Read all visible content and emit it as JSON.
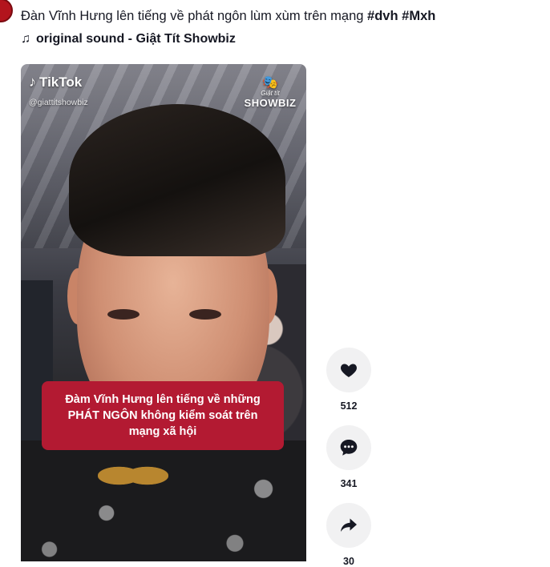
{
  "post": {
    "caption_text": "Đàn Vĩnh Hưng lên tiếng về phát ngôn lùm xùm trên mạng ",
    "hashtags": [
      "#dvh",
      "#Mxh"
    ],
    "music_icon": "music-note-icon",
    "music_label": "original sound - Giật Tít Showbiz"
  },
  "video": {
    "platform_label": "TikTok",
    "handle": "@giattitshowbiz",
    "brand_small": "Giật tít",
    "brand_name": "SHOWBIZ",
    "headline": "Đàm Vĩnh Hưng lên tiếng về những PHÁT NGÔN không kiểm soát trên mạng xã hội"
  },
  "actions": [
    {
      "name": "like",
      "icon": "heart-icon",
      "count": "512"
    },
    {
      "name": "comment",
      "icon": "comment-icon",
      "count": "341"
    },
    {
      "name": "share",
      "icon": "share-icon",
      "count": "30"
    }
  ],
  "colors": {
    "headline_bg": "#b31a32",
    "action_circle": "#f1f1f2",
    "text": "#161823"
  }
}
